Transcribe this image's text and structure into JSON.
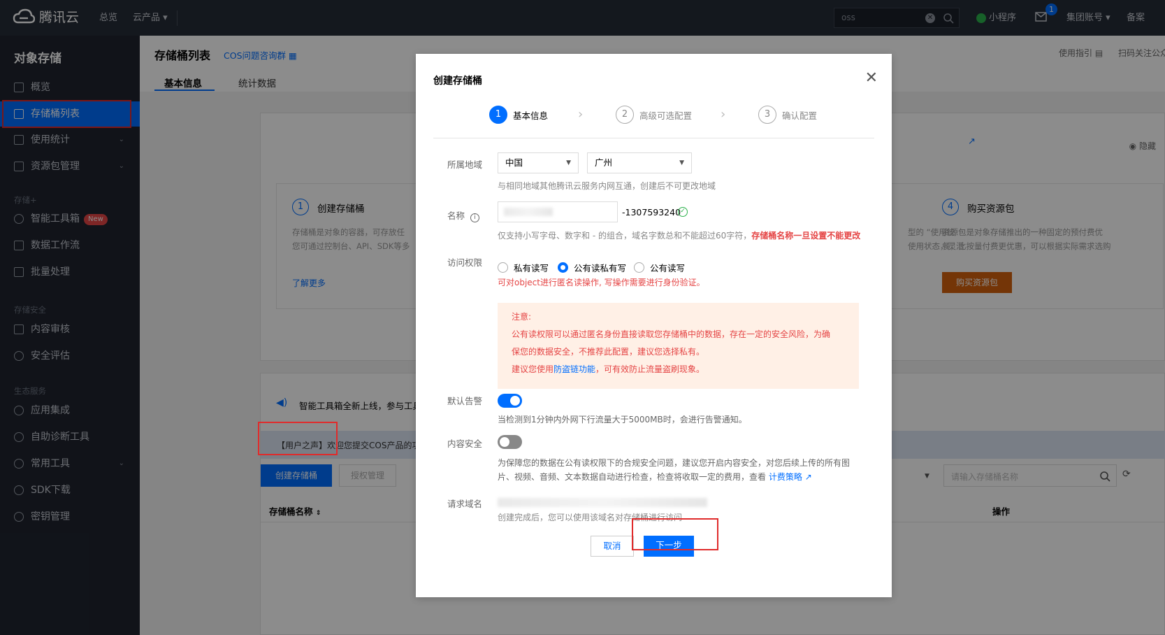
{
  "topbar": {
    "brand": "腾讯云",
    "nav": [
      "总览",
      "云产品 ▾"
    ],
    "search_value": "oss",
    "mini_program": "小程序",
    "mail_count": "1",
    "account": "集团账号 ▾",
    "filing": "备案"
  },
  "sidebar": {
    "title": "对象存储",
    "items": [
      {
        "label": "概览"
      },
      {
        "label": "存储桶列表"
      },
      {
        "label": "使用统计"
      },
      {
        "label": "资源包管理"
      }
    ],
    "group_storage": "存储+",
    "storage_items": [
      {
        "label": "智能工具箱"
      },
      {
        "label": "数据工作流"
      },
      {
        "label": "批量处理"
      }
    ],
    "new_badge": "New",
    "group_security": "存储安全",
    "security_items": [
      {
        "label": "内容审核"
      },
      {
        "label": "安全评估"
      }
    ],
    "group_eco": "生态服务",
    "eco_items": [
      {
        "label": "应用集成"
      },
      {
        "label": "自助诊断工具"
      },
      {
        "label": "常用工具"
      },
      {
        "label": "SDK下载"
      },
      {
        "label": "密钥管理"
      }
    ]
  },
  "page": {
    "title": "存储桶列表",
    "cos_group": "COS问题咨询群",
    "tabs": [
      "基本信息",
      "统计数据"
    ],
    "guide": "使用指引",
    "scan": "扫码关注公众",
    "hide": "隐藏",
    "card1_num": "1",
    "card1_title": "创建存储桶",
    "card1_desc1": "存储桶是对象的容器，可存放任",
    "card1_desc2": "您可通过控制台、API、SDK等多",
    "card1_link": "了解更多",
    "card3_desc1": "型的 “使用统",
    "card3_desc2": "使用状态，灵活",
    "card4_num": "4",
    "card4_title": "购买资源包",
    "card4_desc1": "资源包是对象存储推出的一种固定的预付费优",
    "card4_desc2": "餐，比按量付费更优惠，可以根据实际需求选购",
    "card4_btn": "购买资源包",
    "announce": "智能工具箱全新上线，参与工具",
    "voice": "【用户之声】欢迎您提交COS产品的功",
    "create_btn": "创建存储桶",
    "auth_btn": "授权管理",
    "search_placeholder": "请输入存储桶名称",
    "col_name": "存储桶名称",
    "col_op": "操作"
  },
  "modal": {
    "title": "创建存储桶",
    "steps": [
      {
        "num": "1",
        "label": "基本信息"
      },
      {
        "num": "2",
        "label": "高级可选配置"
      },
      {
        "num": "3",
        "label": "确认配置"
      }
    ],
    "region_label": "所属地域",
    "region_country": "中国",
    "region_city": "广州",
    "region_hint": "与相同地域其他腾讯云服务内网互通，创建后不可更改地域",
    "name_label": "名称",
    "name_suffix": "-1307593240",
    "name_hint": "仅支持小写字母、数字和 - 的组合，域名字数总和不能超过60字符，",
    "name_hint_red": "存储桶名称一旦设置不能更改",
    "access_label": "访问权限",
    "access_options": [
      "私有读写",
      "公有读私有写",
      "公有读写"
    ],
    "access_warn": "可对object进行匿名读操作, 写操作需要进行身份验证。",
    "notice_title": "注意:",
    "notice_line1": "公有读权限可以通过匿名身份直接读取您存储桶中的数据，存在一定的安全风险，为确",
    "notice_line2": "保您的数据安全，不推荐此配置，建议您选择私有。",
    "notice_line3a": "建议您使用",
    "notice_line3_link": "防盗链功能",
    "notice_line3b": "，可有效防止流量盗刷现象。",
    "alarm_label": "默认告警",
    "alarm_hint": "当检测到1分钟内外网下行流量大于5000MB时，会进行告警通知。",
    "content_label": "内容安全",
    "content_hint1": "为保障您的数据在公有读权限下的合规安全问题，建议您开启内容安全，对您后续上传的所有图",
    "content_hint2": "片、视频、音频、文本数据自动进行检查，检查将收取一定的费用，查看",
    "content_link": "计费策略",
    "domain_label": "请求域名",
    "domain_hint": "创建完成后，您可以使用该域名对存储桶进行访问",
    "cancel": "取消",
    "next": "下一步"
  },
  "colors": {
    "primary": "#006eff",
    "danger": "#e54545",
    "orange": "#d4620e",
    "highlight_box": "#e02b2b"
  }
}
